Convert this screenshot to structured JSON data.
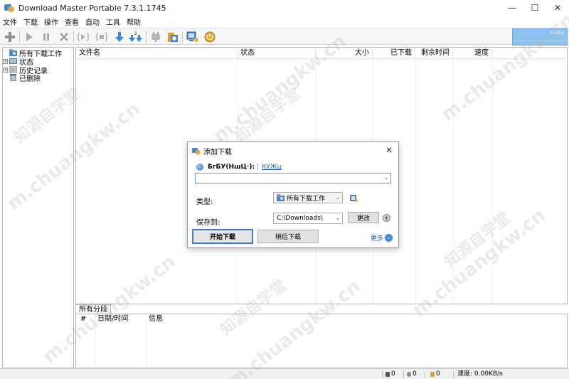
{
  "window": {
    "title": "Download Master Portable 7.3.1.1745"
  },
  "window_controls": {
    "minimize": "—",
    "maximize": "☐",
    "close": "✕"
  },
  "menu": [
    "文件",
    "下载",
    "操作",
    "查看",
    "自动",
    "工具",
    "帮助"
  ],
  "toolbar": {
    "buttons": [
      "add-icon",
      "play-icon",
      "pause-icon",
      "delete-icon",
      "start-all-icon",
      "stop-all-icon",
      "download-icon",
      "download-multi-icon",
      "plugin-icon",
      "scheduler-icon",
      "site-manager-icon",
      "power-icon"
    ],
    "speed_label": "5 KB/s"
  },
  "tree": {
    "items": [
      {
        "label": "所有下载工作",
        "expander": ""
      },
      {
        "label": "状态",
        "expander": "+"
      },
      {
        "label": "历史记录",
        "expander": "+"
      },
      {
        "label": "已删除",
        "expander": ""
      }
    ]
  },
  "list": {
    "columns": [
      "文件名",
      "状态",
      "大小",
      "已下载",
      "剩余时间",
      "速度"
    ]
  },
  "bottom": {
    "tab": "所有分段",
    "columns": [
      "#",
      "日期/时间",
      "信息"
    ]
  },
  "status": {
    "c1": "0",
    "c2": "0",
    "c3": "0",
    "speed": "速度: 0.00KB/s"
  },
  "dialog": {
    "title": "添加下载",
    "url_label": "БгБУ(НшЦ·):",
    "url_link": "КУЖц",
    "url_value": "",
    "type_label": "类型:",
    "type_value": "所有下载工作",
    "save_label": "保存到:",
    "save_value": "C:\\Downloads\\",
    "change_button": "更改",
    "start_button": "开始下载",
    "later_button": "稍后下载",
    "more_link": "更多"
  },
  "watermark": {
    "site": "m.chuangkw.cn",
    "name": "知源自学堂"
  },
  "colors": {
    "accent": "#3c7fd1",
    "speed_box": "#8ec2ee",
    "link": "#1a5fb4"
  }
}
